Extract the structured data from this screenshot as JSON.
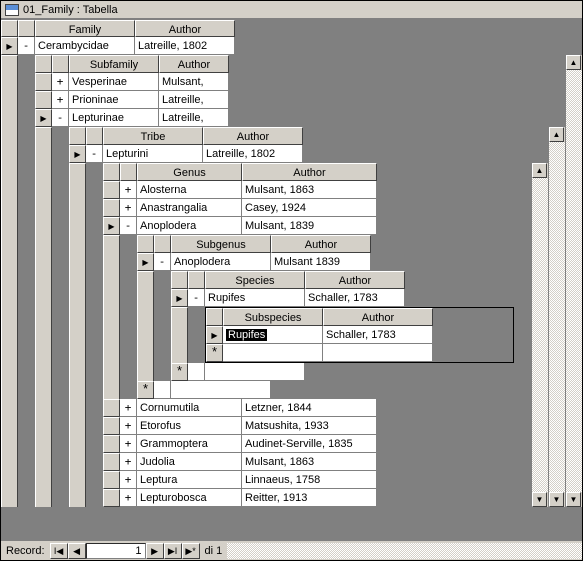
{
  "window": {
    "title": "01_Family : Tabella"
  },
  "nav": {
    "label": "Record:",
    "value": "1",
    "total": "di 1"
  },
  "headers": {
    "family": "Family",
    "subfamily": "Subfamily",
    "tribe": "Tribe",
    "genus": "Genus",
    "subgenus": "Subgenus",
    "species": "Species",
    "subspecies": "Subspecies",
    "author": "Author"
  },
  "family": {
    "name": "Cerambycidae",
    "author": "Latreille, 1802"
  },
  "subfamilies": [
    {
      "exp": "+",
      "name": "Vesperinae",
      "author": "Mulsant,"
    },
    {
      "exp": "+",
      "name": "Prioninae",
      "author": "Latreille,"
    },
    {
      "exp": "-",
      "name": "Lepturinae",
      "author": "Latreille,"
    }
  ],
  "tribe": {
    "name": "Lepturini",
    "author": "Latreille, 1802"
  },
  "genera_top": [
    {
      "exp": "+",
      "name": "Alosterna",
      "author": "Mulsant, 1863"
    },
    {
      "exp": "+",
      "name": "Anastrangalia",
      "author": "Casey, 1924"
    },
    {
      "exp": "-",
      "name": "Anoplodera",
      "author": "Mulsant, 1839"
    }
  ],
  "subgenus": {
    "name": "Anoplodera",
    "author": "Mulsant 1839"
  },
  "species": {
    "name": "Rupifes",
    "author": "Schaller, 1783"
  },
  "subspecies": {
    "name": "Rupifes",
    "author": "Schaller, 1783"
  },
  "genera_bottom": [
    {
      "exp": "+",
      "name": "Cornumutila",
      "author": "Letzner, 1844"
    },
    {
      "exp": "+",
      "name": "Etorofus",
      "author": "Matsushita, 1933"
    },
    {
      "exp": "+",
      "name": "Grammoptera",
      "author": "Audinet-Serville, 1835"
    },
    {
      "exp": "+",
      "name": "Judolia",
      "author": "Mulsant, 1863"
    },
    {
      "exp": "+",
      "name": "Leptura",
      "author": "Linnaeus, 1758"
    },
    {
      "exp": "+",
      "name": "Lepturobosca",
      "author": "Reitter, 1913"
    }
  ]
}
